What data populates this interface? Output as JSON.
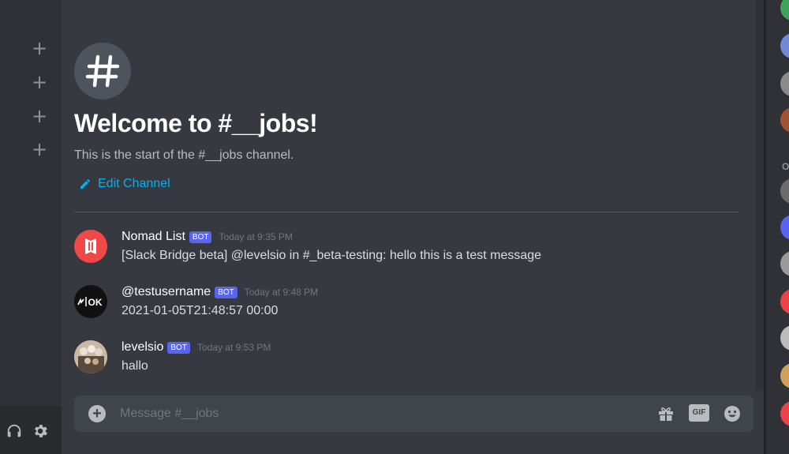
{
  "sidebar": {
    "add_buttons": [
      "+",
      "+",
      "+",
      "+"
    ]
  },
  "channel": {
    "welcome_title": "Welcome to #__jobs!",
    "welcome_subtitle": "This is the start of the #__jobs channel.",
    "edit_label": "Edit Channel"
  },
  "messages": [
    {
      "author": "Nomad List",
      "badge": "BOT",
      "time": "Today at 9:35 PM",
      "text": "[Slack Bridge beta] @levelsio in #_beta-testing: hello this is a test message"
    },
    {
      "author": "@testusername",
      "badge": "BOT",
      "time": "Today at 9:48 PM",
      "text": "2021-01-05T21:48:57 00:00",
      "avatar_text": "OK"
    },
    {
      "author": "levelsio",
      "badge": "BOT",
      "time": "Today at 9:53 PM",
      "text": "hallo"
    }
  ],
  "composer": {
    "placeholder": "Message #__jobs",
    "gif_label": "GIF"
  },
  "member_list": {
    "section_letter": "O"
  },
  "colors": {
    "accent_blurple": "#5865f2",
    "link_blue": "#00b0f4",
    "nomad_red": "#f04747"
  }
}
